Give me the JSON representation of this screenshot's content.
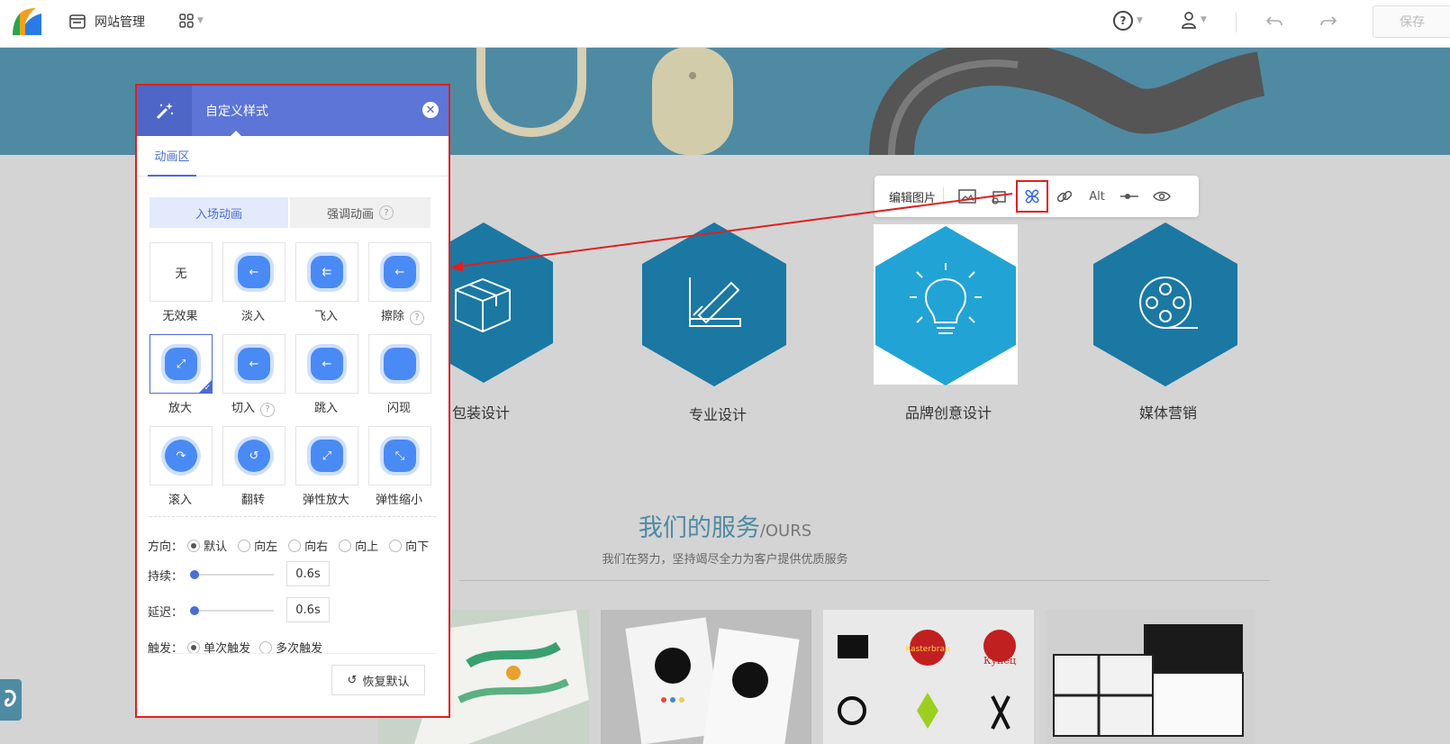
{
  "topbar": {
    "site_manage_label": "网站管理",
    "save_label": "保存"
  },
  "services": [
    {
      "label": "包装设计",
      "icon": "box-icon"
    },
    {
      "label": "专业设计",
      "icon": "ruler-pencil-icon"
    },
    {
      "label": "品牌创意设计",
      "icon": "lightbulb-icon"
    },
    {
      "label": "媒体营销",
      "icon": "film-reel-icon"
    }
  ],
  "section": {
    "title_cn": "我们的服务",
    "title_en": "/OURS",
    "subtitle": "我们在努力，坚持竭尽全力为客户提供优质服务"
  },
  "image_toolbar": {
    "edit_label": "编辑图片",
    "alt_label": "Alt"
  },
  "panel": {
    "title": "自定义样式",
    "tab": "动画区",
    "seg_enter": "入场动画",
    "seg_emphasis": "强调动画",
    "none_glyph": "无",
    "effects": [
      "无效果",
      "淡入",
      "飞入",
      "擦除",
      "放大",
      "切入",
      "跳入",
      "闪现",
      "滚入",
      "翻转",
      "弹性放大",
      "弹性缩小"
    ],
    "selected_effect": "放大",
    "direction_label": "方向：",
    "directions": [
      "默认",
      "向左",
      "向右",
      "向上",
      "向下"
    ],
    "selected_direction": "默认",
    "duration_label": "持续：",
    "duration_value": "0.6s",
    "delay_label": "延迟：",
    "delay_value": "0.6s",
    "trigger_label": "触发：",
    "triggers": [
      "单次触发",
      "多次触发"
    ],
    "selected_trigger": "单次触发",
    "reset_label": "恢复默认"
  },
  "colors": {
    "accent": "#4a6cd4",
    "panel_header": "#5c75d6",
    "hex_blue": "#1a78a3",
    "hex_selected": "#22a3d6",
    "annotation_red": "#e02020"
  }
}
